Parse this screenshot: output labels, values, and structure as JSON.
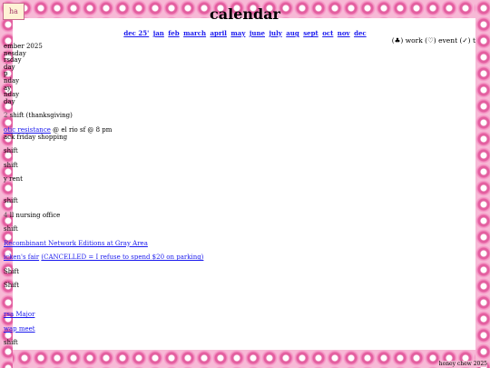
{
  "header": {
    "logo_text": "ha",
    "title": "calendar"
  },
  "nav": {
    "months": [
      "dec 25'",
      "jan",
      "feb",
      "march",
      "april",
      "may",
      "june",
      "july",
      "aug",
      "sept",
      "oct",
      "nov",
      "dec"
    ]
  },
  "legend": "(♣) work (♡) event (✓) t",
  "month_heading": "ember 2025",
  "weekdays": [
    "nesday",
    "rsday",
    "day",
    "p",
    "nday",
    "ay",
    "nday",
    "day"
  ],
  "events": [
    {
      "day": "2",
      "text": "shift (thanksgiving)",
      "link": ""
    },
    {
      "day": "",
      "text": "",
      "link": ""
    },
    {
      "day": "",
      "text": "@ el rio sf @ 8 pm",
      "link": "otic resistance"
    },
    {
      "day": "",
      "text": "ack friday shopping",
      "link": ""
    },
    {
      "day": "",
      "text": "shift",
      "link": ""
    },
    {
      "day": "",
      "text": "shift",
      "link": ""
    },
    {
      "day": "",
      "text": "y rent",
      "link": ""
    },
    {
      "day": "",
      "text": "shift",
      "link": ""
    },
    {
      "day": "4",
      "text": "ll nursing office",
      "link": ""
    },
    {
      "day": "",
      "text": "shift",
      "link": ""
    },
    {
      "day": "",
      "text": "",
      "link": "Recombinant Network Editions at Gray Area"
    },
    {
      "day": "",
      "text": "(CANCELLED = I refuse to spend $20 on parking)",
      "link": "icken's fair"
    },
    {
      "day": "",
      "text": "Shift",
      "link": ""
    },
    {
      "day": "",
      "text": "Shift",
      "link": ""
    },
    {
      "day": "",
      "text": "",
      "link": "rsa Major"
    },
    {
      "day": "",
      "text": "",
      "link": "wap meet"
    },
    {
      "day": "",
      "text": "shift",
      "link": ""
    }
  ],
  "footer": "honey chew 2025"
}
